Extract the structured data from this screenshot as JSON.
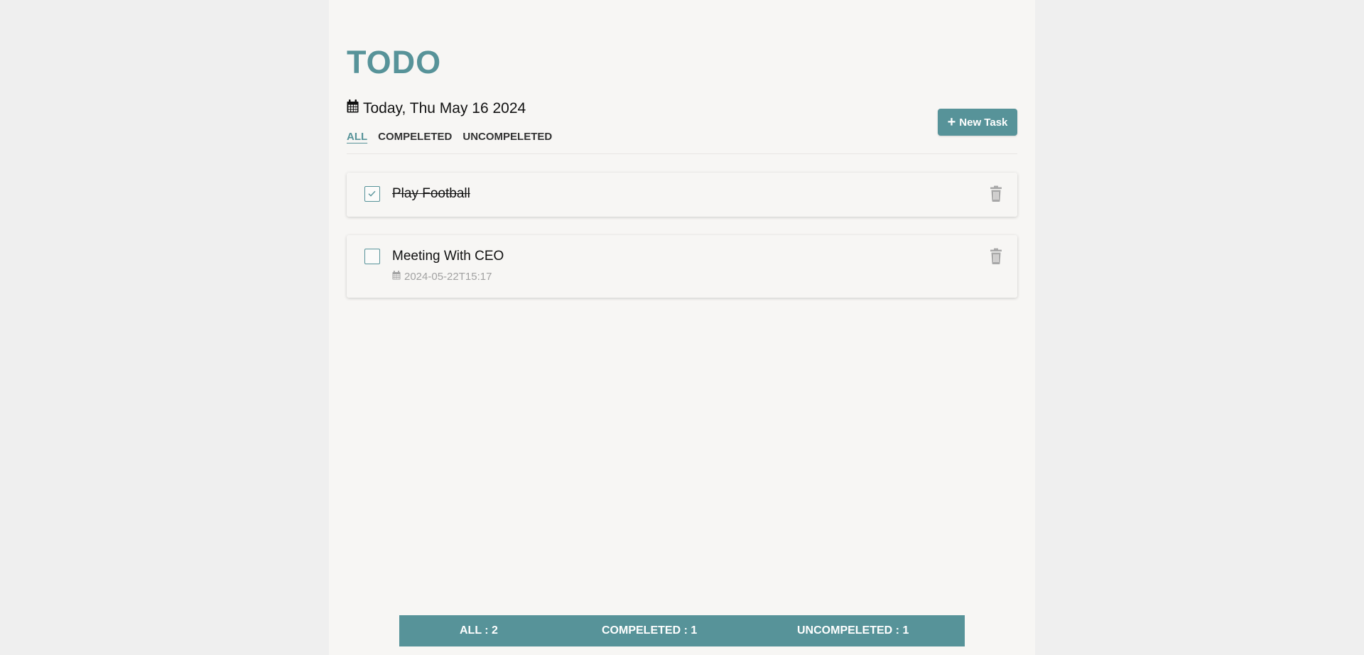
{
  "app": {
    "title": "TODO"
  },
  "header": {
    "date_icon": "calendar-icon",
    "date_label": "Today, Thu May 16 2024",
    "new_task_icon": "plus-icon",
    "new_task_label": "New Task"
  },
  "filters": {
    "active": "ALL",
    "tabs": [
      {
        "label": "ALL"
      },
      {
        "label": "COMPELETED"
      },
      {
        "label": "UNCOMPELETED"
      }
    ]
  },
  "tasks": [
    {
      "title": "Play Football",
      "completed": true,
      "due": ""
    },
    {
      "title": "Meeting With CEO",
      "completed": false,
      "due": "2024-05-22T15:17"
    }
  ],
  "footer": {
    "all": "ALL : 2",
    "completed": "COMPELETED : 1",
    "uncompleted": "UNCOMPELETED : 1"
  },
  "colors": {
    "accent": "#579399",
    "page_background": "#f7f6f4",
    "outer_background": "#efefef",
    "muted_text": "#a2a2a2"
  }
}
